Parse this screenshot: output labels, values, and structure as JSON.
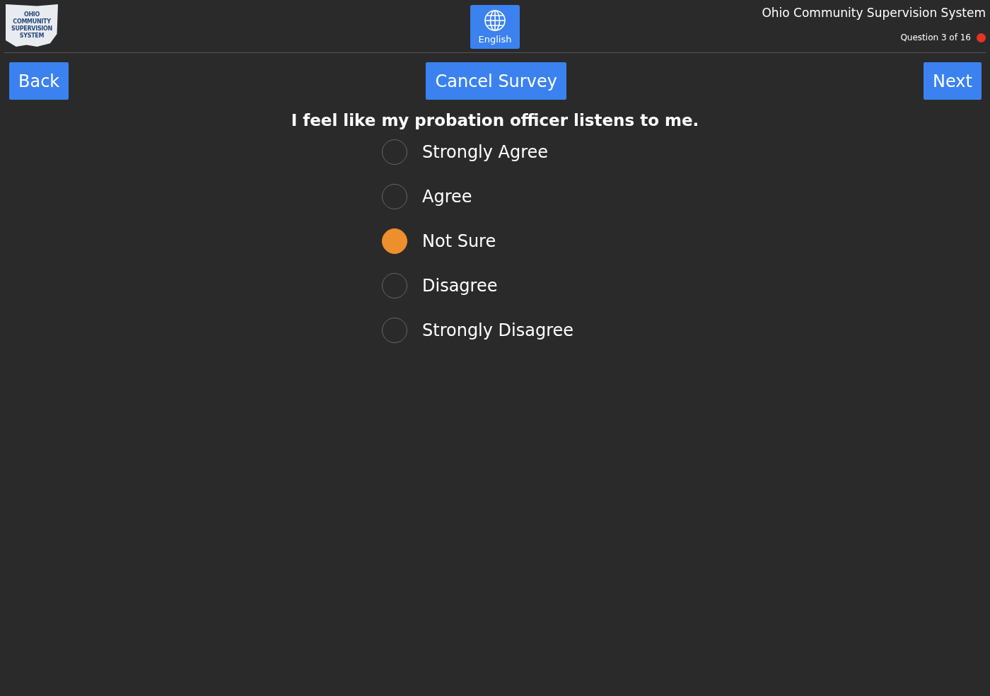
{
  "header": {
    "logo": {
      "lines": [
        "OHIO",
        "COMMUNITY",
        "SUPERVISION",
        "SYSTEM"
      ]
    },
    "language_button": "English",
    "title": "Ohio Community Supervision System",
    "progress": {
      "text": "Question 3 of 16",
      "color": "#e53422"
    }
  },
  "nav": {
    "back": "Back",
    "cancel": "Cancel Survey",
    "next": "Next"
  },
  "question": "I feel like my probation officer listens to me.",
  "options": [
    {
      "label": "Strongly Agree",
      "selected": false
    },
    {
      "label": "Agree",
      "selected": false
    },
    {
      "label": "Not Sure",
      "selected": true
    },
    {
      "label": "Disagree",
      "selected": false
    },
    {
      "label": "Strongly Disagree",
      "selected": false
    }
  ]
}
